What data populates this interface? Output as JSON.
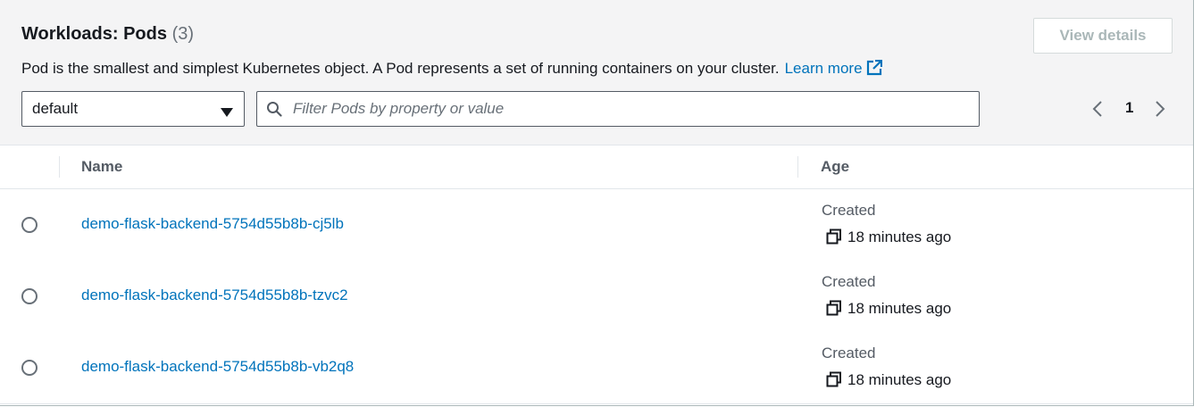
{
  "header": {
    "title": "Workloads: Pods",
    "count": "(3)",
    "view_details_label": "View details",
    "description": "Pod is the smallest and simplest Kubernetes object. A Pod represents a set of running containers on your cluster.",
    "learn_more_label": "Learn more"
  },
  "namespace_select": {
    "value": "default"
  },
  "filter": {
    "placeholder": "Filter Pods by property or value",
    "value": ""
  },
  "pagination": {
    "current_page": "1"
  },
  "table": {
    "columns": [
      "Name",
      "Age"
    ],
    "rows": [
      {
        "name": "demo-flask-backend-5754d55b8b-cj5lb",
        "age_label": "Created",
        "age": "18 minutes ago"
      },
      {
        "name": "demo-flask-backend-5754d55b8b-tzvc2",
        "age_label": "Created",
        "age": "18 minutes ago"
      },
      {
        "name": "demo-flask-backend-5754d55b8b-vb2q8",
        "age_label": "Created",
        "age": "18 minutes ago"
      }
    ]
  },
  "colors": {
    "link": "#0073bb",
    "header_bg": "#f4f4f5",
    "text": "#16191f",
    "muted": "#687078"
  },
  "icons": [
    "external-link-icon",
    "caret-down-icon",
    "search-icon",
    "chevron-left-icon",
    "chevron-right-icon",
    "copy-icon"
  ]
}
